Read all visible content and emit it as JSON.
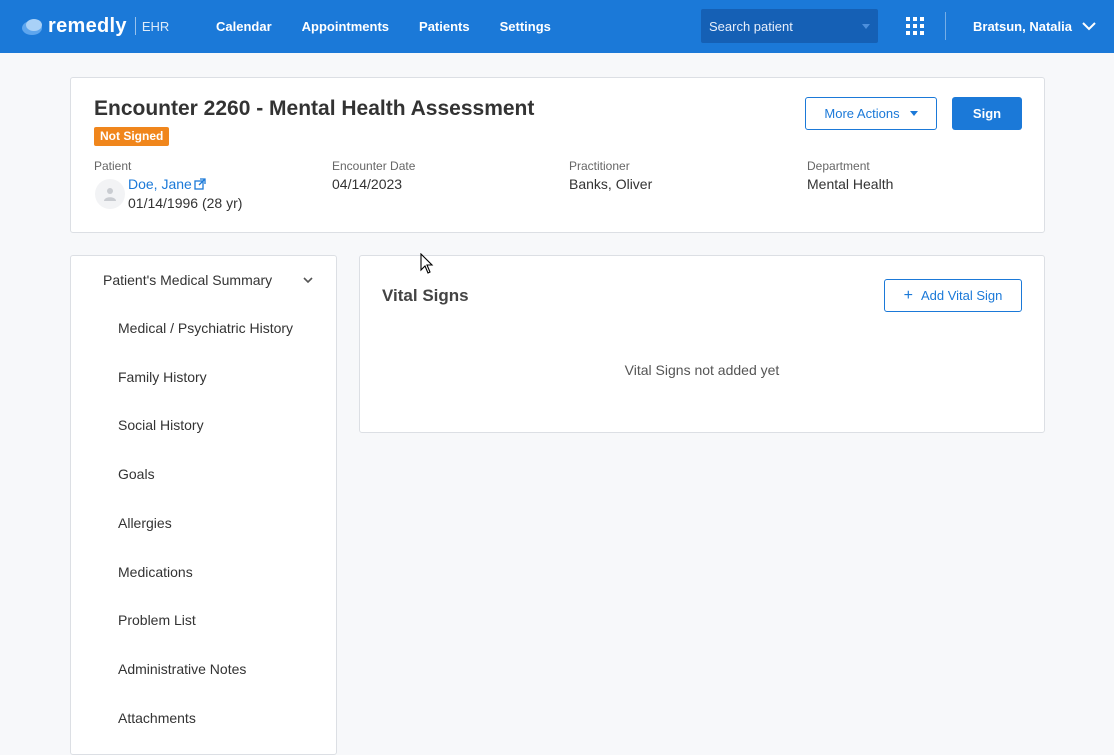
{
  "brand": {
    "name": "remedly",
    "sub": "EHR"
  },
  "nav": {
    "items": [
      "Calendar",
      "Appointments",
      "Patients",
      "Settings"
    ]
  },
  "search": {
    "placeholder": "Search patient"
  },
  "user": {
    "name": "Bratsun, Natalia"
  },
  "encounter": {
    "title": "Encounter 2260 - Mental Health Assessment",
    "status": "Not Signed",
    "more_actions_label": "More Actions",
    "sign_label": "Sign",
    "patient_label": "Patient",
    "patient_name": "Doe, Jane",
    "patient_dob": "01/14/1996 (28 yr)",
    "date_label": "Encounter Date",
    "date": "04/14/2023",
    "practitioner_label": "Practitioner",
    "practitioner": "Banks, Oliver",
    "department_label": "Department",
    "department": "Mental Health"
  },
  "sidebar": {
    "header": "Patient's Medical Summary",
    "items": [
      "Medical / Psychiatric History",
      "Family History",
      "Social History",
      "Goals",
      "Allergies",
      "Medications",
      "Problem List",
      "Administrative Notes",
      "Attachments"
    ]
  },
  "vitals": {
    "title": "Vital Signs",
    "add_label": "Add Vital Sign",
    "empty_text": "Vital Signs not added yet"
  },
  "colors": {
    "primary": "#1b79d8",
    "badge": "#f0861c"
  }
}
